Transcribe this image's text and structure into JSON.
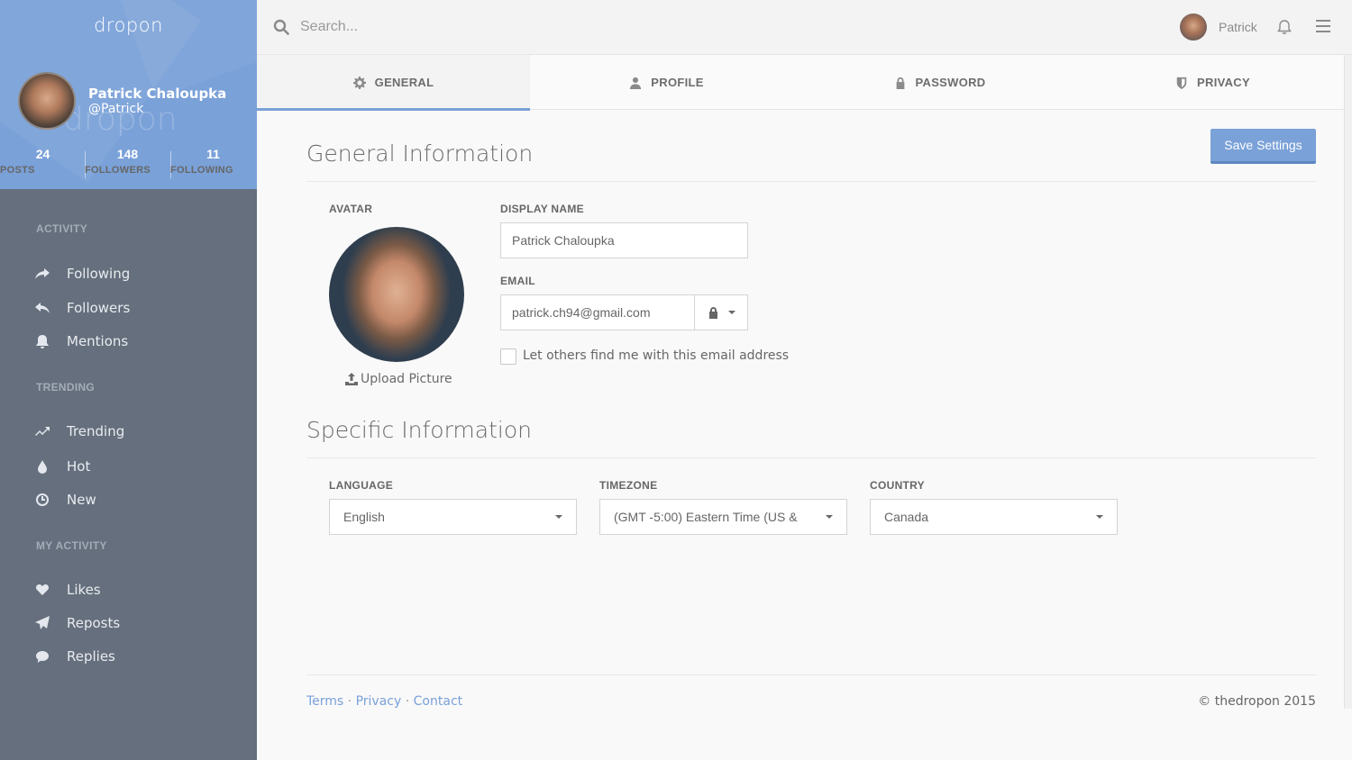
{
  "brand": {
    "logo": "dropon",
    "watermark": "dropon"
  },
  "profile": {
    "name": "Patrick Chaloupka",
    "handle": "@Patrick",
    "stats": [
      {
        "value": "24",
        "label": "POSTS"
      },
      {
        "value": "148",
        "label": "FOLLOWERS"
      },
      {
        "value": "11",
        "label": "FOLLOWING"
      }
    ]
  },
  "sidebar": {
    "sections": [
      {
        "title": "ACTIVITY",
        "items": [
          {
            "label": "Following",
            "icon": "share-icon"
          },
          {
            "label": "Followers",
            "icon": "reply-icon"
          },
          {
            "label": "Mentions",
            "icon": "bell-icon"
          }
        ]
      },
      {
        "title": "TRENDING",
        "items": [
          {
            "label": "Trending",
            "icon": "trending-up-icon"
          },
          {
            "label": "Hot",
            "icon": "drop-icon"
          },
          {
            "label": "New",
            "icon": "clock-icon"
          }
        ]
      },
      {
        "title": "MY ACTIVITY",
        "items": [
          {
            "label": "Likes",
            "icon": "heart-icon"
          },
          {
            "label": "Reposts",
            "icon": "paper-plane-icon"
          },
          {
            "label": "Replies",
            "icon": "speech-bubble-icon"
          }
        ]
      }
    ]
  },
  "topbar": {
    "search_placeholder": "Search...",
    "user": "Patrick"
  },
  "tabs": [
    {
      "label": "GENERAL",
      "icon": "gear-icon",
      "active": true
    },
    {
      "label": "PROFILE",
      "icon": "user-icon",
      "active": false
    },
    {
      "label": "PASSWORD",
      "icon": "lock-icon",
      "active": false
    },
    {
      "label": "PRIVACY",
      "icon": "shield-icon",
      "active": false
    }
  ],
  "general": {
    "title": "General Information",
    "save_label": "Save Settings",
    "avatar_label": "AVATAR",
    "upload_label": "Upload Picture",
    "display_name_label": "DISPLAY NAME",
    "display_name_value": "Patrick Chaloupka",
    "email_label": "EMAIL",
    "email_value": "patrick.ch94@gmail.com",
    "find_by_email_label": "Let others find me with this email address",
    "find_by_email_checked": false
  },
  "specific": {
    "title": "Specific Information",
    "language_label": "LANGUAGE",
    "language_value": "English",
    "timezone_label": "TIMEZONE",
    "timezone_value": "(GMT -5:00) Eastern Time (US &",
    "country_label": "COUNTRY",
    "country_value": "Canada"
  },
  "footer": {
    "links": [
      "Terms",
      "Privacy",
      "Contact"
    ],
    "separator": "·",
    "copyright": "© thedropon 2015"
  },
  "colors": {
    "accent": "#7aa1d8",
    "sidebar": "#656f7d",
    "background": "#f9f9f9"
  }
}
